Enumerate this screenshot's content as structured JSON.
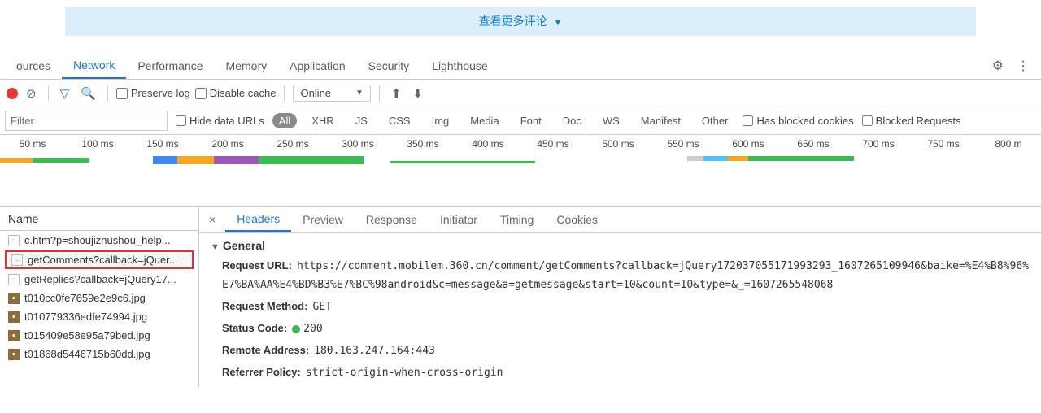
{
  "page": {
    "more_comments_label": "查看更多评论",
    "caret": "▼"
  },
  "devtools": {
    "tabs": [
      "ources",
      "Network",
      "Performance",
      "Memory",
      "Application",
      "Security",
      "Lighthouse"
    ],
    "active_tab": 1,
    "gear_icon": "⚙",
    "menu_icon": "⋮"
  },
  "toolbar": {
    "preserve_log_label": "Preserve log",
    "disable_cache_label": "Disable cache",
    "throttle_label": "Online"
  },
  "filter": {
    "placeholder": "Filter",
    "hide_data_urls_label": "Hide data URLs",
    "types": [
      "All",
      "XHR",
      "JS",
      "CSS",
      "Img",
      "Media",
      "Font",
      "Doc",
      "WS",
      "Manifest",
      "Other"
    ],
    "active_type": 0,
    "has_blocked_cookies_label": "Has blocked cookies",
    "blocked_requests_label": "Blocked Requests"
  },
  "timeline": {
    "ticks": [
      "50 ms",
      "100 ms",
      "150 ms",
      "200 ms",
      "250 ms",
      "300 ms",
      "350 ms",
      "400 ms",
      "450 ms",
      "500 ms",
      "550 ms",
      "600 ms",
      "650 ms",
      "700 ms",
      "750 ms",
      "800 m"
    ]
  },
  "requests": {
    "header": "Name",
    "items": [
      {
        "name": "c.htm?p=shoujizhushou_help...",
        "type": "doc"
      },
      {
        "name": "getComments?callback=jQuer...",
        "type": "doc",
        "selected": true
      },
      {
        "name": "getReplies?callback=jQuery17...",
        "type": "doc"
      },
      {
        "name": "t010cc0fe7659e2e9c6.jpg",
        "type": "img"
      },
      {
        "name": "t010779336edfe74994.jpg",
        "type": "img"
      },
      {
        "name": "t015409e58e95a79bed.jpg",
        "type": "img"
      },
      {
        "name": "t01868d5446715b60dd.jpg",
        "type": "img"
      }
    ]
  },
  "detail": {
    "tabs": [
      "Headers",
      "Preview",
      "Response",
      "Initiator",
      "Timing",
      "Cookies"
    ],
    "active_tab": 0,
    "section_title": "General",
    "kv": {
      "request_url_label": "Request URL:",
      "request_url_value": "https://comment.mobilem.360.cn/comment/getComments?callback=jQuery172037055171993293_1607265109946&baike=%E4%B8%96%E7%BA%AA%E4%BD%B3%E7%BC%98android&c=message&a=getmessage&start=10&count=10&type=&_=1607265548068",
      "request_method_label": "Request Method:",
      "request_method_value": "GET",
      "status_code_label": "Status Code:",
      "status_code_value": "200",
      "remote_address_label": "Remote Address:",
      "remote_address_value": "180.163.247.164:443",
      "referrer_policy_label": "Referrer Policy:",
      "referrer_policy_value": "strict-origin-when-cross-origin"
    }
  }
}
